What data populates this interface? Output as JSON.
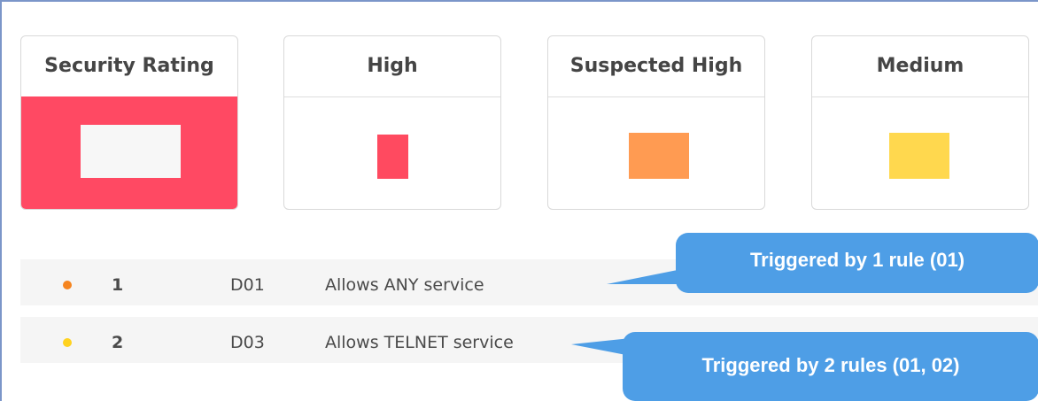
{
  "cards": [
    {
      "title": "Security Rating",
      "color": "#ff4963",
      "swatch_color": "#f7f7f7"
    },
    {
      "title": "High",
      "swatch_color": "#ff4a60"
    },
    {
      "title": "Suspected High",
      "swatch_color": "#ff9b52"
    },
    {
      "title": "Medium",
      "swatch_color": "#ffd84e"
    }
  ],
  "rows": [
    {
      "dot_color": "#f5841f",
      "number": "1",
      "code": "D01",
      "description": "Allows ANY service"
    },
    {
      "dot_color": "#ffd21f",
      "number": "2",
      "code": "D03",
      "description": "Allows TELNET service"
    }
  ],
  "callouts": [
    {
      "text": "Triggered by 1 rule (01)"
    },
    {
      "text": "Triggered by 2 rules (01, 02)"
    }
  ],
  "colors": {
    "callout": "#4e9ee6",
    "frame": "#7b96c9"
  }
}
